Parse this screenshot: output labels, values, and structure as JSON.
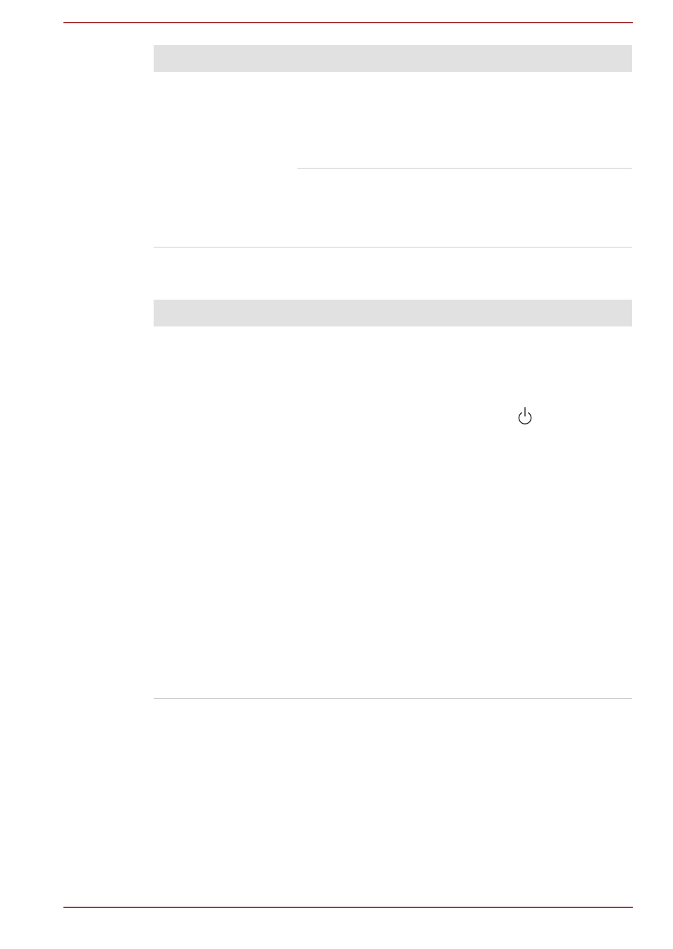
{
  "document": {
    "accent_color": "#a4373a",
    "header_fill": "#e1e1e1",
    "rule_color": "#c8c8c8",
    "icons": [
      "power-icon"
    ]
  }
}
